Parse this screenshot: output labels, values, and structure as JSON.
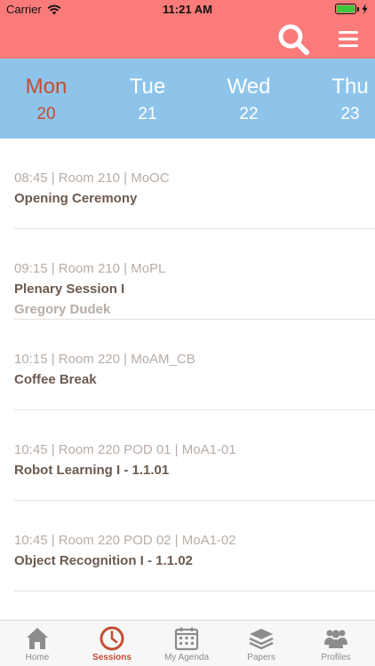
{
  "status_bar": {
    "carrier": "Carrier",
    "time": "11:21 AM",
    "battery_level_fraction": 1.0
  },
  "header": {
    "background_color": "#fb7a7a",
    "search_icon": "magnifier-icon",
    "menu_icon": "hamburger-icon"
  },
  "day_tabs": [
    {
      "name": "Mon",
      "number": "20",
      "active": true
    },
    {
      "name": "Tue",
      "number": "21",
      "active": false
    },
    {
      "name": "Wed",
      "number": "22",
      "active": false
    },
    {
      "name": "Thu",
      "number": "23",
      "active": false
    }
  ],
  "sessions": [
    {
      "meta": "08:45 | Room 210 | MoOC",
      "title": "Opening Ceremony",
      "speaker": ""
    },
    {
      "meta": "09:15 | Room 210 | MoPL",
      "title": "Plenary Session I",
      "speaker": "Gregory Dudek"
    },
    {
      "meta": "10:15 | Room 220 | MoAM_CB",
      "title": "Coffee Break",
      "speaker": ""
    },
    {
      "meta": "10:45 | Room 220 POD 01 | MoA1-01",
      "title": "Robot Learning I - 1.1.01",
      "speaker": ""
    },
    {
      "meta": "10:45 | Room 220 POD 02 | MoA1-02",
      "title": "Object Recognition I - 1.1.02",
      "speaker": ""
    }
  ],
  "tab_bar": [
    {
      "label": "Home",
      "icon": "home-icon",
      "active": false
    },
    {
      "label": "Sessions",
      "icon": "clock-icon",
      "active": true
    },
    {
      "label": "My Agenda",
      "icon": "calendar-icon",
      "active": false
    },
    {
      "label": "Papers",
      "icon": "stack-icon",
      "active": false
    },
    {
      "label": "Profiles",
      "icon": "people-icon",
      "active": false
    }
  ],
  "colors": {
    "accent": "#c44d33",
    "day_bar": "#8ec4ea",
    "title_text": "#6d5a4f",
    "meta_text": "#b9ada6"
  }
}
